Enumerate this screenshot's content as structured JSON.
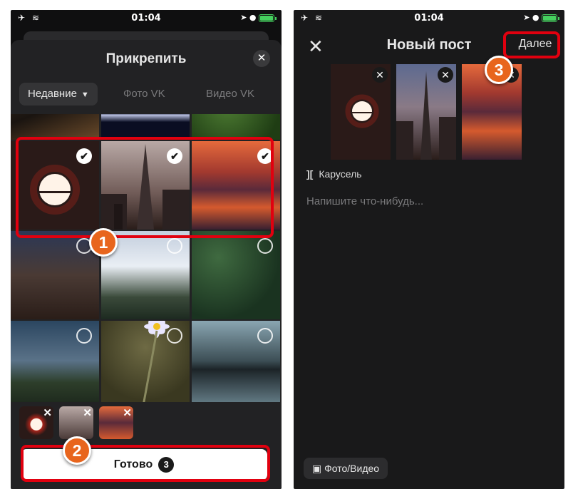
{
  "status": {
    "time": "01:04",
    "left_icons": "✈ ≋",
    "right_icons": "➤ ●"
  },
  "left": {
    "title": "Прикрепить",
    "tabs": {
      "recent": "Недавние",
      "photo": "Фото VK",
      "video": "Видео VK"
    },
    "done_button": {
      "label": "Готово",
      "count": "3"
    },
    "grid_photos": [
      "city-road-night",
      "city-lights-night",
      "fern-leaves",
      "red-sun",
      "shard-skyscraper",
      "sunset-sea",
      "city-street-dusk",
      "snowy-mountains",
      "green-leaves",
      "mountain-night-sky",
      "white-flower",
      "mountain-reflection"
    ],
    "selected": [
      "red-sun",
      "shard-skyscraper",
      "sunset-sea"
    ]
  },
  "right": {
    "title": "Новый пост",
    "next_button": "Далее",
    "carousel_label": "Карусель",
    "compose_placeholder": "Напишите что-нибудь...",
    "photo_video_button": "Фото/Видео"
  },
  "annotations": {
    "badge1": "1",
    "badge2": "2",
    "badge3": "3",
    "color": "#e1000f",
    "badge_color": "#e8651d"
  }
}
